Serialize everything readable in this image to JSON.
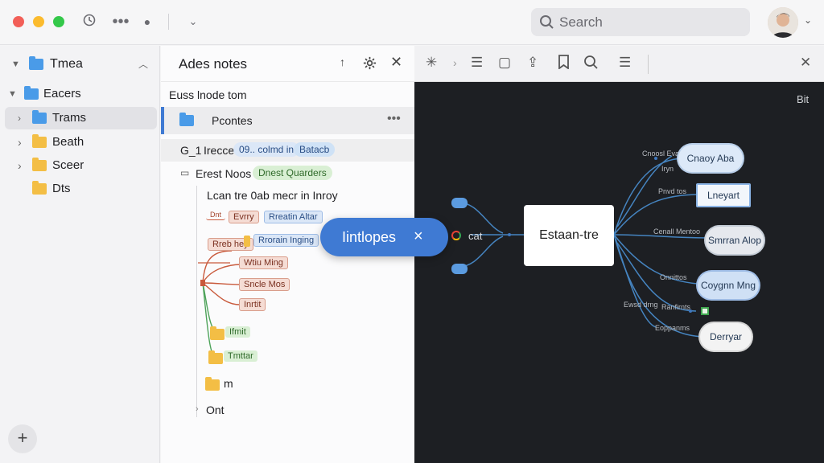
{
  "titlebar": {
    "search_placeholder": "Search",
    "icons": [
      "history-icon",
      "more-icon",
      "dot-icon",
      "chevron-down-icon"
    ]
  },
  "sidebar": {
    "root": "Tmea",
    "items": [
      {
        "label": "Eacers"
      },
      {
        "label": "Trams"
      },
      {
        "label": "Beath"
      },
      {
        "label": "Sceer"
      },
      {
        "label": "Dts"
      }
    ],
    "add_label": "+"
  },
  "notes": {
    "title": "Ades notes",
    "subtitle": "Euss lnode tom",
    "selected_row": "Pcontes",
    "row2_prefix": "G_1",
    "row2_label": "Irecce",
    "row2_pill_a": "09.. colmd in",
    "row2_pill_b": "Batacb",
    "row3_label": "Erest Noos",
    "row3_pill": "Dnest Quarders",
    "tree_text": "Lcan tre 0ab mecr in Inroy",
    "nodes": {
      "n1": "Evrry",
      "n2": "Dnt",
      "n3": "Rreatin Altar",
      "n4": "Rreb hey",
      "n5": "Rrorain Inging",
      "n6": "Wtiu Ming",
      "n7": "Sncle Mos",
      "n8": "Inrtit",
      "n9": "Ifmit",
      "n10": "Tmttar",
      "n11": "m",
      "n12": "Ont"
    }
  },
  "popup": {
    "label": "Iintlopes",
    "close": "×"
  },
  "canvas": {
    "corner_label": "Bit",
    "center_node": "Estaan-tre",
    "left_label": "cat",
    "branch_labels": [
      "Cnoosl Evac",
      "Iryn",
      "Pnvd tos",
      "Cenall Mentoo",
      "Onnittos",
      "Ranfirnts",
      "Eoppanms",
      "Ewsd drng"
    ],
    "clouds": [
      "Cnaoy Aba",
      "Lneyart",
      "Smrran Alop",
      "Coygnn Mng",
      "Derryar"
    ]
  },
  "colors": {
    "accent": "#3f7ad3",
    "folder_blue": "#4a9be8",
    "folder_yellow": "#f3be45",
    "canvas_bg": "#1d1f23",
    "line_blue": "#4a8fd1"
  }
}
